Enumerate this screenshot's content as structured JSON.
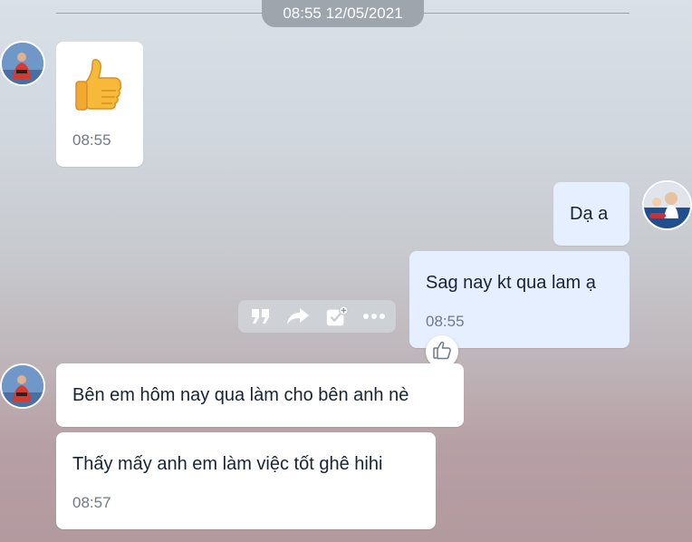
{
  "date_separator": "08:55 12/05/2021",
  "messages": [
    {
      "sender": "left",
      "content_icon": "thumbs-up-emoji",
      "time": "08:55"
    },
    {
      "sender": "right",
      "text": "Dạ a"
    },
    {
      "sender": "right",
      "text": "Sag nay kt qua lam ạ",
      "time": "08:55"
    },
    {
      "sender": "left",
      "text": "Bên em hôm nay qua làm cho bên anh nè"
    },
    {
      "sender": "left",
      "text": "Thấy mấy anh em làm việc tốt ghê hihi",
      "time": "08:57"
    }
  ],
  "toolbar": {
    "icons": [
      "quote-icon",
      "forward-icon",
      "add-task-icon",
      "more-icon"
    ]
  },
  "reaction_icon": "thumbs-up-outline-icon",
  "colors": {
    "incoming_bubble": "#ffffff",
    "outgoing_bubble": "#e5efff",
    "text": "#172433",
    "time": "#6f7a86",
    "date_pill": "#9ea5ad"
  }
}
